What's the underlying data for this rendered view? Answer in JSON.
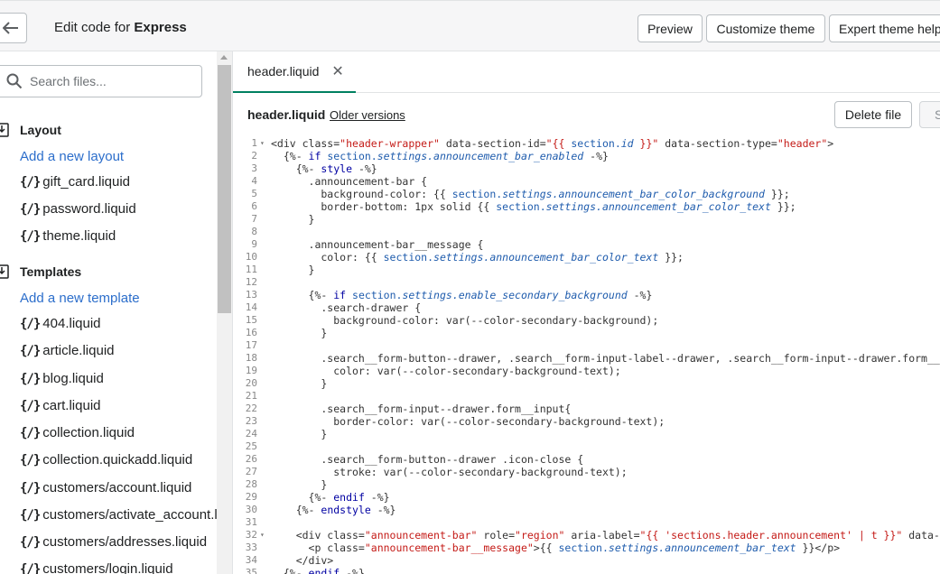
{
  "topbar": {
    "title_prefix": "Edit code for",
    "title_theme": "Express",
    "preview_label": "Preview",
    "customize_label": "Customize theme",
    "expert_label": "Expert theme help"
  },
  "sidebar": {
    "search_placeholder": "Search files...",
    "layout": {
      "heading": "Layout",
      "add_label": "Add a new layout",
      "files": [
        "gift_card.liquid",
        "password.liquid",
        "theme.liquid"
      ]
    },
    "templates": {
      "heading": "Templates",
      "add_label": "Add a new template",
      "files": [
        "404.liquid",
        "article.liquid",
        "blog.liquid",
        "cart.liquid",
        "collection.liquid",
        "collection.quickadd.liquid",
        "customers/account.liquid",
        "customers/activate_account.liquid",
        "customers/addresses.liquid",
        "customers/login.liquid"
      ]
    }
  },
  "editor": {
    "tab_label": "header.liquid",
    "file_name": "header.liquid",
    "older_versions_label": "Older versions",
    "delete_label": "Delete file",
    "save_label": "Save",
    "line_numbers": [
      "1",
      "2",
      "3",
      "4",
      "5",
      "6",
      "7",
      "8",
      "9",
      "10",
      "11",
      "12",
      "13",
      "14",
      "15",
      "16",
      "17",
      "18",
      "19",
      "20",
      "21",
      "22",
      "23",
      "24",
      "25",
      "26",
      "27",
      "28",
      "29",
      "30",
      "31",
      "32",
      "33",
      "34",
      "35"
    ],
    "code_lines": [
      "<div class=\"header-wrapper\" data-section-id=\"{{ section.id }}\" data-section-type=\"header\">",
      "  {%- if section.settings.announcement_bar_enabled -%}",
      "    {%- style -%}",
      "      .announcement-bar {",
      "        background-color: {{ section.settings.announcement_bar_color_background }};",
      "        border-bottom: 1px solid {{ section.settings.announcement_bar_color_text }};",
      "      }",
      "",
      "      .announcement-bar__message {",
      "        color: {{ section.settings.announcement_bar_color_text }};",
      "      }",
      "",
      "      {%- if section.settings.enable_secondary_background -%}",
      "        .search-drawer {",
      "          background-color: var(--color-secondary-background);",
      "        }",
      "",
      "        .search__form-button--drawer, .search__form-input-label--drawer, .search__form-input--drawer.form__",
      "          color: var(--color-secondary-background-text);",
      "        }",
      "",
      "        .search__form-input--drawer.form__input{",
      "          border-color: var(--color-secondary-background-text);",
      "        }",
      "",
      "        .search__form-button--drawer .icon-close {",
      "          stroke: var(--color-secondary-background-text);",
      "        }",
      "      {%- endif -%}",
      "    {%- endstyle -%}",
      "",
      "    <div class=\"announcement-bar\" role=\"region\" aria-label=\"{{ 'sections.header.announcement' | t }}\" data-",
      "      <p class=\"announcement-bar__message\">{{ section.settings.announcement_bar_text }}</p>",
      "    </div>",
      "  {%- endif -%}"
    ]
  }
}
